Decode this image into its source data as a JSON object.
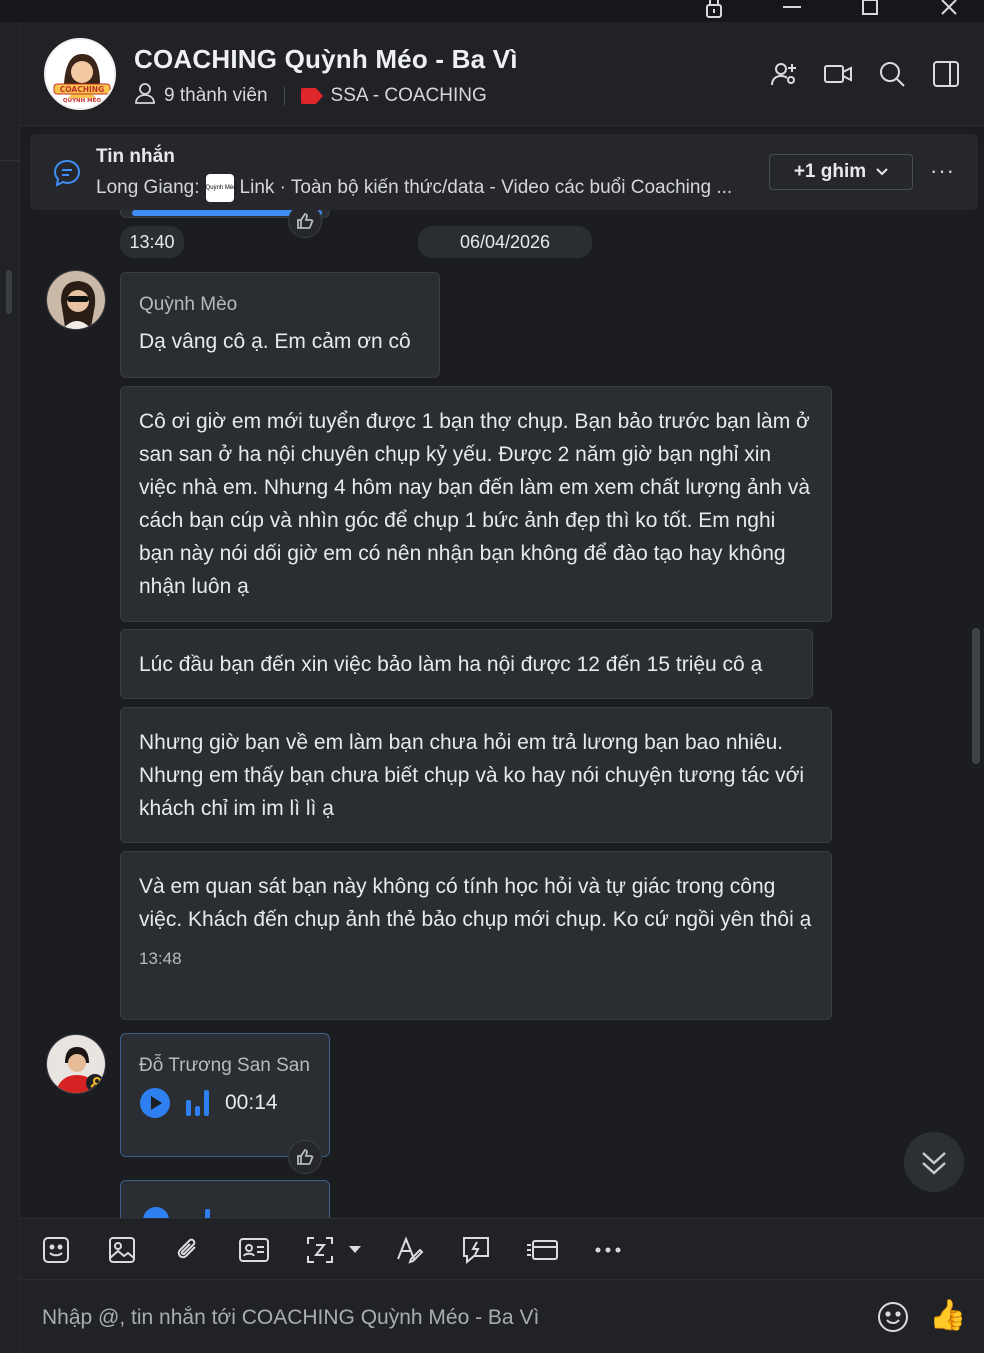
{
  "header": {
    "title": "COACHING Quỳnh Méo - Ba Vì",
    "members": "9 thành viên",
    "tag": "SSA - COACHING",
    "avatar_text_1": "COACHING",
    "avatar_text_2": "QUỲNH MÉO"
  },
  "pinned": {
    "title": "Tin nhắn",
    "sender": "Long Giang:",
    "mini_logo": "Quỳnh Méo",
    "text": "Link · Toàn bộ kiến thức/data - Video các buổi Coaching ...",
    "more_pins": "+1 ghim",
    "more": "···"
  },
  "chat": {
    "time_prev": "13:40",
    "date_divider": "06/04/2026",
    "messages": [
      {
        "sender": "Quỳnh Mèo",
        "text": "Dạ vâng cô ạ. Em cảm ơn cô"
      },
      {
        "text": "Cô ơi giờ em mới tuyển được 1 bạn thợ chụp. Bạn bảo trước bạn làm ở san san ở ha nội chuyên chụp kỷ yếu. Được 2 năm giờ bạn nghỉ xin việc nhà em. Nhưng 4 hôm nay bạn đến làm em xem chất lượng ảnh và cách bạn cúp và nhìn góc để chụp 1 bức ảnh đẹp thì ko tốt. Em nghi bạn này nói dối giờ em có nên nhận bạn không để đào tạo hay không nhận luôn ạ"
      },
      {
        "text": "Lúc đầu bạn đến xin việc bảo làm ha nội được 12 đến 15 triệu cô ạ"
      },
      {
        "text": "Nhưng giờ bạn về em làm bạn chưa hỏi em trả lương bạn bao nhiêu. Nhưng em thấy bạn chưa biết chụp và ko hay nói chuyện tương tác với khách chỉ im im lì lì ạ"
      },
      {
        "text": "Và em quan sát bạn này không có tính học hỏi và tự giác trong công việc. Khách đến chụp ảnh thẻ bảo chụp mới chụp. Ko cứ ngồi yên thôi ạ",
        "time": "13:48"
      },
      {
        "sender": "Đỗ Trương San San",
        "voice_duration": "00:14"
      }
    ]
  },
  "input": {
    "placeholder": "Nhập @, tin nhắn tới COACHING Quỳnh Méo - Ba Vì",
    "thumb": "👍"
  },
  "colors": {
    "background": "#1b1d21",
    "bubble": "#2a2d32",
    "accent": "#3d8ff5",
    "tag_red": "#e0252b"
  },
  "icons": [
    "lock-icon",
    "minimize-icon",
    "restore-icon",
    "close-icon",
    "add-member-icon",
    "video-call-icon",
    "search-icon",
    "sidebar-toggle-icon",
    "chat-bubble-icon",
    "chevron-down-icon",
    "thumbs-up-icon",
    "play-icon",
    "sound-wave-icon",
    "scroll-down-icon",
    "sticker-icon",
    "image-icon",
    "attachment-icon",
    "contact-card-icon",
    "screenshot-icon",
    "text-format-icon",
    "quick-message-icon",
    "card-icon",
    "more-icon",
    "emoji-icon"
  ]
}
